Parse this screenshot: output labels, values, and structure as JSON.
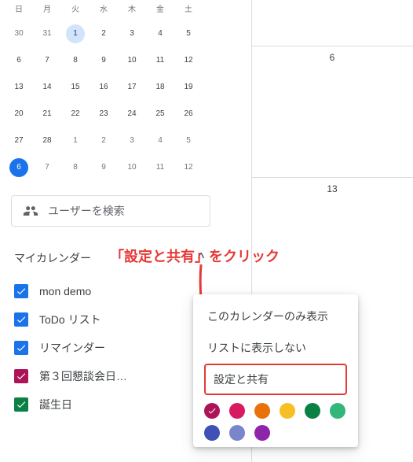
{
  "mini_cal": {
    "dow": [
      "日",
      "月",
      "火",
      "水",
      "木",
      "金",
      "土"
    ],
    "weeks": [
      {
        "days": [
          "30",
          "31",
          "1",
          "2",
          "3",
          "4",
          "5"
        ],
        "oth": [
          0,
          1
        ],
        "sel": 2
      },
      {
        "days": [
          "6",
          "7",
          "8",
          "9",
          "10",
          "11",
          "12"
        ]
      },
      {
        "days": [
          "13",
          "14",
          "15",
          "16",
          "17",
          "18",
          "19"
        ]
      },
      {
        "days": [
          "20",
          "21",
          "22",
          "23",
          "24",
          "25",
          "26"
        ]
      },
      {
        "days": [
          "27",
          "28",
          "1",
          "2",
          "3",
          "4",
          "5"
        ],
        "oth": [
          2,
          3,
          4,
          5,
          6
        ]
      },
      {
        "days": [
          "6",
          "7",
          "8",
          "9",
          "10",
          "11",
          "12"
        ],
        "oth": [
          1,
          2,
          3,
          4,
          5,
          6
        ],
        "cur": 0
      }
    ]
  },
  "search": {
    "placeholder": "ユーザーを検索"
  },
  "my_cal_header": "マイカレンダー",
  "calendars": [
    {
      "name": "mon demo",
      "color": "#1a73e8",
      "hover": false
    },
    {
      "name": "ToDo リスト",
      "color": "#1a73e8",
      "hover": false
    },
    {
      "name": "リマインダー",
      "color": "#1a73e8",
      "hover": false
    },
    {
      "name": "第３回懇談会日…",
      "color": "#ad1457",
      "hover": true
    },
    {
      "name": "誕生日",
      "color": "#0b8043",
      "hover": false
    }
  ],
  "popup": {
    "only_show": "このカレンダーのみ表示",
    "hide": "リストに表示しない",
    "settings": "設定と共有",
    "colors": [
      "#ad1457",
      "#d81b60",
      "#e8710a",
      "#f6bf26",
      "#0b8043",
      "#33b679",
      "#3f51b5",
      "#7986cb",
      "#8e24aa"
    ],
    "selected_color": 0
  },
  "main_dates": {
    "d1": "6",
    "d2": "13"
  },
  "annotation": "「設定と共有」をクリック"
}
